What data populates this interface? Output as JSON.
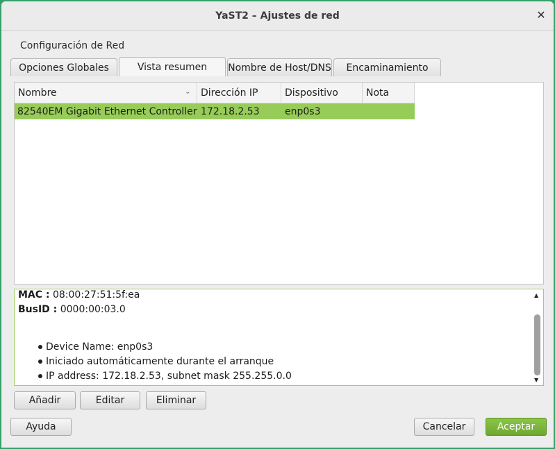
{
  "window": {
    "title": "YaST2 – Ajustes de red",
    "close_glyph": "✕"
  },
  "section_label": "Configuración de Red",
  "tabs": [
    {
      "label": "Opciones Globales",
      "active": false
    },
    {
      "label": "Vista resumen",
      "active": true
    },
    {
      "label": "Nombre de Host/DNS",
      "active": false
    },
    {
      "label": "Encaminamiento",
      "active": false
    }
  ],
  "table": {
    "columns": [
      "Nombre",
      "Dirección IP",
      "Dispositivo",
      "Nota"
    ],
    "sort_icon": "chevron-down-icon",
    "sort_glyph": "⌄",
    "rows": [
      {
        "nombre": "82540EM Gigabit Ethernet Controller",
        "ip": "172.18.2.53",
        "dispositivo": "enp0s3",
        "nota": "",
        "selected": true
      }
    ]
  },
  "details": {
    "mac_label": "MAC :",
    "mac_value": "08:00:27:51:5f:ea",
    "busid_label": "BusID :",
    "busid_value": "0000:00:03.0",
    "bullets": [
      "Device Name: enp0s3",
      "Iniciado automáticamente durante el arranque",
      "IP address: 172.18.2.53, subnet mask 255.255.0.0"
    ],
    "scroll_up_glyph": "▲",
    "scroll_down_glyph": "▼"
  },
  "actions": {
    "add": "Añadir",
    "edit": "Editar",
    "delete": "Eliminar"
  },
  "footer": {
    "help": "Ayuda",
    "cancel": "Cancelar",
    "accept": "Aceptar"
  },
  "colors": {
    "accent_green": "#97cc58",
    "primary_button": "#7ab73b",
    "desktop": "#35a06a"
  }
}
